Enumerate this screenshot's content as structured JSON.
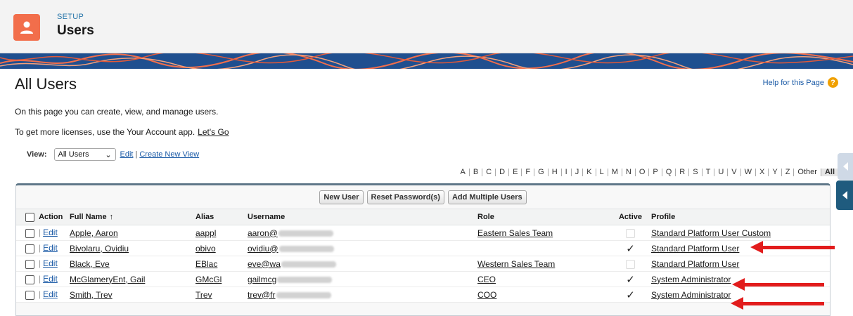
{
  "header": {
    "setup_label": "SETUP",
    "title": "Users",
    "icon": "user-icon",
    "accent_color": "#f26e4b"
  },
  "main": {
    "title": "All Users",
    "help_link": "Help for this Page",
    "description": "On this page you can create, view, and manage users.",
    "licenses_text": "To get more licenses, use the Your Account app.",
    "licenses_link": "Let's Go"
  },
  "view": {
    "label": "View:",
    "selected": "All Users",
    "edit_link": "Edit",
    "separator": "|",
    "create_link": "Create New View"
  },
  "alphabet": [
    "A",
    "B",
    "C",
    "D",
    "E",
    "F",
    "G",
    "H",
    "I",
    "J",
    "K",
    "L",
    "M",
    "N",
    "O",
    "P",
    "Q",
    "R",
    "S",
    "T",
    "U",
    "V",
    "W",
    "X",
    "Y",
    "Z",
    "Other",
    "All"
  ],
  "alphabet_active": "All",
  "buttons": {
    "new_user": "New User",
    "reset_password": "Reset Password(s)",
    "add_multiple": "Add Multiple Users"
  },
  "table": {
    "headers": {
      "action": "Action",
      "full_name": "Full Name",
      "sort_indicator": "↑",
      "alias": "Alias",
      "username": "Username",
      "role": "Role",
      "active": "Active",
      "profile": "Profile"
    },
    "edit_label": "Edit",
    "pipe": "|",
    "rows": [
      {
        "full_name": "Apple, Aaron",
        "alias": "aappl",
        "username": "aaron@",
        "role": "Eastern Sales Team",
        "active": false,
        "profile": "Standard Platform User Custom"
      },
      {
        "full_name": "Bivolaru, Ovidiu",
        "alias": "obivo",
        "username": "ovidiu@",
        "role": "",
        "active": true,
        "profile": "Standard Platform User"
      },
      {
        "full_name": "Black, Eve",
        "alias": "EBlac",
        "username": "eve@wa",
        "role": "Western Sales Team",
        "active": false,
        "profile": "Standard Platform User"
      },
      {
        "full_name": "McGlameryEnt, Gail",
        "alias": "GMcGl",
        "username": "gailmcg",
        "role": "CEO",
        "active": true,
        "profile": "System Administrator"
      },
      {
        "full_name": "Smith, Trev",
        "alias": "Trev",
        "username": "trev@fr",
        "role": "COO",
        "active": true,
        "profile": "System Administrator"
      }
    ]
  },
  "annotation_color": "#e21c1c"
}
